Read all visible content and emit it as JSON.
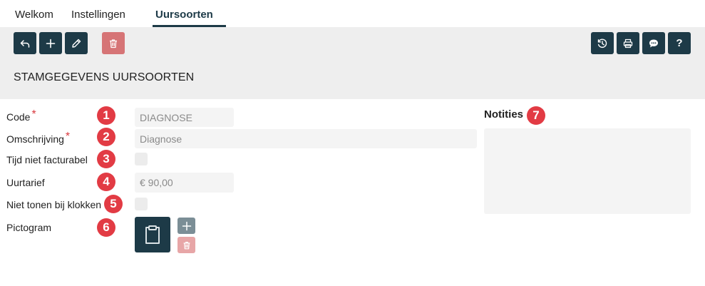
{
  "tabs": [
    {
      "label": "Welkom",
      "active": false
    },
    {
      "label": "Instellingen",
      "active": false
    },
    {
      "label": "Uursoorten",
      "active": true
    }
  ],
  "toolbar": {
    "left_icons": [
      "back-icon",
      "plus-icon",
      "pencil-icon",
      "trash-icon"
    ],
    "right_icons": [
      "history-icon",
      "print-icon",
      "chat-icon",
      "help-icon"
    ],
    "help_label": "?"
  },
  "page_title": "STAMGEGEVENS UURSOORTEN",
  "form": {
    "code": {
      "label": "Code",
      "required": "*",
      "badge": "1",
      "value": "DIAGNOSE"
    },
    "omschrijving": {
      "label": "Omschrijving",
      "required": "*",
      "badge": "2",
      "value": "Diagnose"
    },
    "tijd": {
      "label": "Tijd niet facturabel",
      "badge": "3",
      "checked": false
    },
    "uurtarief": {
      "label": "Uurtarief",
      "badge": "4",
      "value": "€ 90,00"
    },
    "niet_tonen": {
      "label": "Niet tonen bij klokken",
      "badge": "5",
      "checked": false
    },
    "pictogram": {
      "label": "Pictogram",
      "badge": "6",
      "icon": "clipboard-icon"
    }
  },
  "notes": {
    "title": "Notities",
    "badge": "7",
    "value": ""
  },
  "colors": {
    "primary": "#1d3a47",
    "danger": "#d67476",
    "badge": "#e23b44",
    "header_bg": "#eeeeee"
  }
}
